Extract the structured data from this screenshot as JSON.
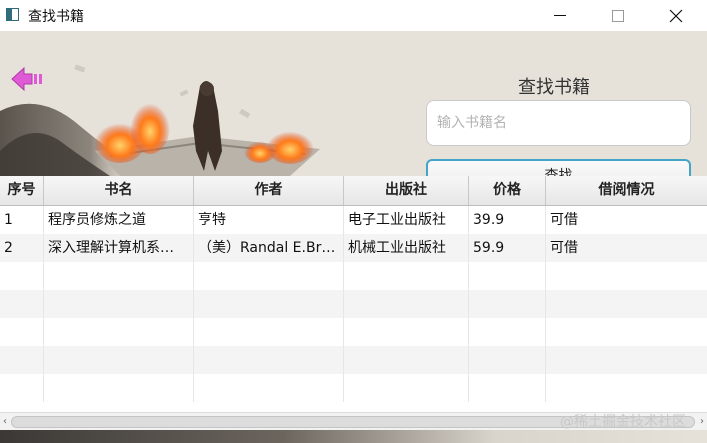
{
  "window": {
    "title": "查找书籍"
  },
  "header": {
    "search_title": "查找书籍",
    "search_placeholder": "输入书籍名",
    "search_value": "",
    "search_button": "查找"
  },
  "table": {
    "columns": [
      "序号",
      "书名",
      "作者",
      "出版社",
      "价格",
      "借阅情况"
    ],
    "rows": [
      [
        "1",
        "程序员修炼之道",
        "亨特",
        "电子工业出版社",
        "39.9",
        "可借"
      ],
      [
        "2",
        "深入理解计算机系…",
        "（美）Randal E.Br…",
        "机械工业出版社",
        "59.9",
        "可借"
      ]
    ]
  },
  "watermark": "@稀土掘金技术社区",
  "colors": {
    "accent": "#42a5c8",
    "back_icon": "#e05ad8"
  }
}
